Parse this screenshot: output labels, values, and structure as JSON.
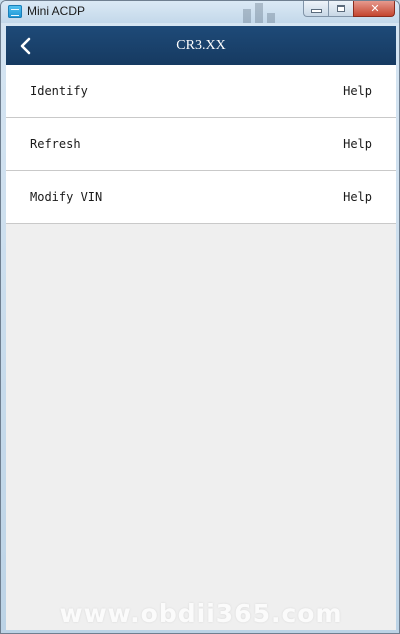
{
  "window": {
    "title": "Mini ACDP",
    "minimize_icon": "minimize-icon",
    "maximize_icon": "maximize-icon",
    "close_icon": "close-icon",
    "close_glyph": "✕"
  },
  "header": {
    "title": "CR3.XX",
    "back_icon": "chevron-left-icon",
    "background_color": "#1e4a78"
  },
  "menu": {
    "items": [
      {
        "label": "Identify",
        "help": "Help"
      },
      {
        "label": "Refresh",
        "help": "Help"
      },
      {
        "label": "Modify VIN",
        "help": "Help"
      }
    ]
  },
  "watermark": "www.obdii365.com"
}
